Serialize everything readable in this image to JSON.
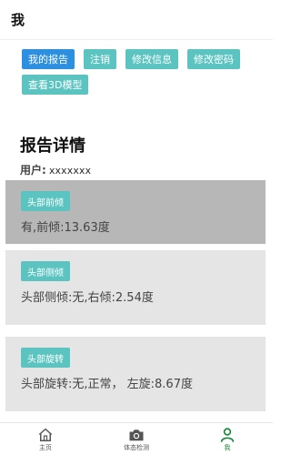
{
  "header": {
    "title": "我"
  },
  "actions": [
    {
      "label": "我的报告",
      "active": true
    },
    {
      "label": "注销",
      "active": false
    },
    {
      "label": "修改信息",
      "active": false
    },
    {
      "label": "修改密码",
      "active": false
    },
    {
      "label": "查看3D模型",
      "active": false
    }
  ],
  "report": {
    "title": "报告详情",
    "user_label": "用户:",
    "user_value": "xxxxxxx",
    "sections": [
      {
        "tag": "头部前倾",
        "text": "有,前倾:13.63度"
      },
      {
        "tag": "头部侧倾",
        "text": "头部侧倾:无,右倾:2.54度"
      },
      {
        "tag": "头部旋转",
        "text": "头部旋转:无,正常， 左旋:8.67度"
      }
    ]
  },
  "nav": [
    {
      "label": "主页",
      "icon": "home-icon"
    },
    {
      "label": "体态检测",
      "icon": "camera-icon"
    },
    {
      "label": "我",
      "icon": "person-icon",
      "active": true
    }
  ],
  "colors": {
    "accent": "#5bc4c1",
    "active_button": "#2d8fe0",
    "nav_active": "#1a8a3a"
  }
}
